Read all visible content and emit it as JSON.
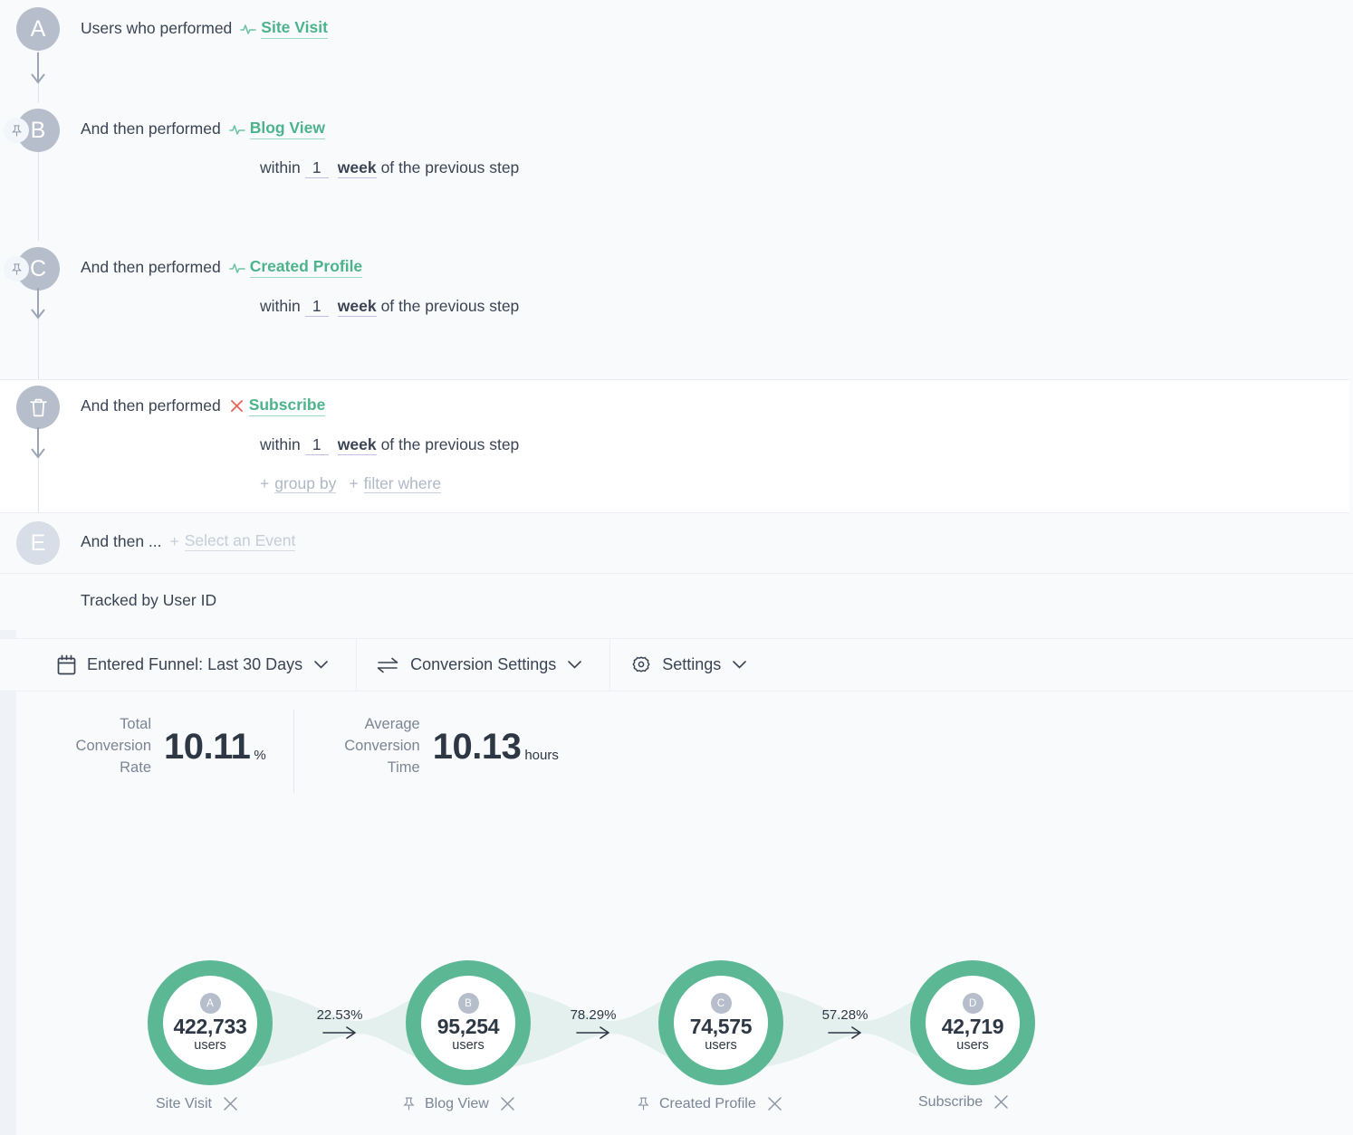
{
  "steps": [
    {
      "letter": "A",
      "lead": "Users who performed",
      "event": "Site Visit",
      "event_icon": "pulse-icon",
      "pinned": false,
      "hovered": false,
      "within": null
    },
    {
      "letter": "B",
      "lead": "And then performed",
      "event": "Blog View",
      "event_icon": "pulse-icon",
      "pinned": true,
      "hovered": false,
      "within": {
        "prefix": "within",
        "value": "1",
        "unit": "week",
        "suffix": "of the previous step"
      }
    },
    {
      "letter": "C",
      "lead": "And then performed",
      "event": "Created Profile",
      "event_icon": "pulse-icon",
      "pinned": true,
      "hovered": false,
      "within": {
        "prefix": "within",
        "value": "1",
        "unit": "week",
        "suffix": "of the previous step"
      }
    },
    {
      "letter": "D",
      "lead": "And then performed",
      "event": "Subscribe",
      "event_icon": "close-x-icon",
      "pinned": false,
      "hovered": true,
      "within": {
        "prefix": "within",
        "value": "1",
        "unit": "week",
        "suffix": "of the previous step"
      },
      "group_by_label": "group by",
      "filter_where_label": "filter where",
      "plus": "+"
    }
  ],
  "next_step": {
    "letter": "E",
    "lead": "And then ...",
    "plus": "+",
    "select_event_label": "Select an Event"
  },
  "tracked_by": "Tracked by User ID",
  "toolbar": {
    "date_range": "Entered Funnel: Last 30 Days",
    "conversion_settings": "Conversion Settings",
    "settings": "Settings"
  },
  "metrics": [
    {
      "label_lines": [
        "Total",
        "Conversion",
        "Rate"
      ],
      "value": "10.11",
      "unit": "%"
    },
    {
      "label_lines": [
        "Average",
        "Conversion",
        "Time"
      ],
      "value": "10.13",
      "unit": "hours"
    }
  ],
  "chart_data": {
    "type": "bar",
    "title": "",
    "xlabel": "",
    "ylabel": "users",
    "categories": [
      "Site Visit",
      "Blog View",
      "Created Profile",
      "Subscribe"
    ],
    "values": [
      422733,
      95254,
      74575,
      42719
    ],
    "value_labels": [
      "422,733",
      "95,254",
      "74,575",
      "42,719"
    ],
    "step_letters": [
      "A",
      "B",
      "C",
      "D"
    ],
    "unit_label": "users",
    "conversion_labels": [
      "22.53%",
      "78.29%",
      "57.28%"
    ],
    "conversion_values": [
      22.53,
      78.29,
      57.28
    ],
    "pinned": [
      false,
      true,
      true,
      false
    ],
    "total_conversion_rate": 10.11,
    "average_conversion_time_hours": 10.13,
    "legend": "",
    "grid": false
  },
  "colors": {
    "accent_green": "#5CB894",
    "event_link": "#4DB38C",
    "band": "#E3F0EE",
    "badge_grey": "#B6BECC",
    "row_bg": "#F8FAFC",
    "row_hover_bg": "#FFFFFF",
    "underline_purple": "#C7BBE6",
    "x_red": "#E8645A"
  }
}
